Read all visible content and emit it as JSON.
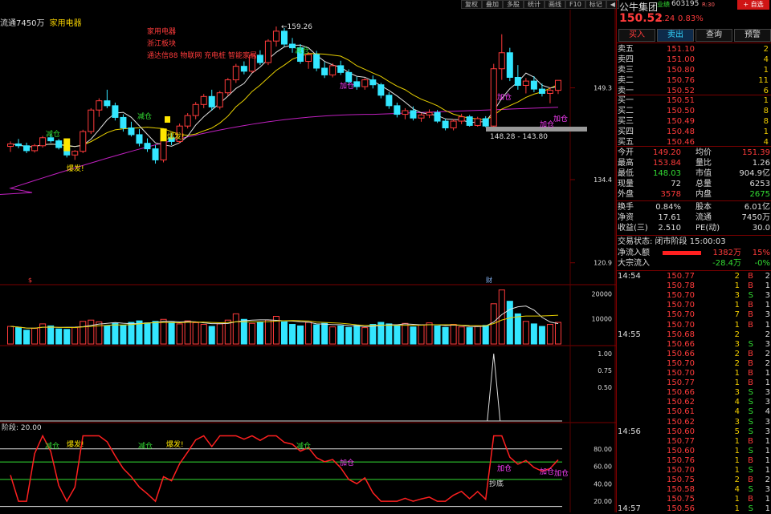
{
  "toolbar": {
    "buttons": [
      "复权",
      "叠加",
      "多股",
      "统计",
      "画线",
      "F10",
      "标记"
    ],
    "glyph": "◀"
  },
  "chart_header": {
    "left_text": "流通7450万",
    "sector": "家用电器"
  },
  "info_box": [
    "家用电器",
    "浙江板块",
    "通达信88 物联网 充电桩 智能家居"
  ],
  "price_axis": [
    "149.3",
    "134.4",
    "120.9"
  ],
  "price_annotations": {
    "high": "159.26",
    "range": "148.28 - 143.80"
  },
  "signals": {
    "jiancang": "减仓",
    "baofa": "爆发!",
    "jiacang": "加仓",
    "chaodi": "抄底"
  },
  "event_marks": [
    "$",
    "财"
  ],
  "volume_axis": [
    "20000",
    "10000"
  ],
  "osc_axis": [
    "1.00",
    "0.75",
    "0.50"
  ],
  "lower_title": "阶段: 20.00",
  "lower_axis": [
    "80.00",
    "60.00",
    "40.00",
    "20.00"
  ],
  "colors": {
    "up": "#ff3b3b",
    "down": "#33e6ff",
    "ma_yellow": "#e8d000",
    "ma_white": "#e0e0e0",
    "ma_purple": "#c020c0",
    "line_red": "#ff2020"
  },
  "stock": {
    "name": "公牛集团",
    "tag": "业绩",
    "code": "603195",
    "code_note": "R:30",
    "add_btn": "+ 自选",
    "price": "150.52",
    "change": "1.24",
    "pct": "0.83%"
  },
  "trade_buttons": [
    "买入",
    "卖出",
    "查询",
    "预警"
  ],
  "order_book": {
    "asks": [
      {
        "label": "卖五",
        "price": "151.10",
        "vol": "2"
      },
      {
        "label": "卖四",
        "price": "151.00",
        "vol": "4"
      },
      {
        "label": "卖三",
        "price": "150.80",
        "vol": "1"
      },
      {
        "label": "卖二",
        "price": "150.76",
        "vol": "11"
      },
      {
        "label": "卖一",
        "price": "150.52",
        "vol": "6"
      }
    ],
    "bids": [
      {
        "label": "买一",
        "price": "150.51",
        "vol": "1"
      },
      {
        "label": "买二",
        "price": "150.50",
        "vol": "8"
      },
      {
        "label": "买三",
        "price": "150.49",
        "vol": "8"
      },
      {
        "label": "买四",
        "price": "150.48",
        "vol": "1"
      },
      {
        "label": "买五",
        "price": "150.46",
        "vol": "4"
      }
    ]
  },
  "stats": [
    {
      "l1": "今开",
      "v1": "149.20",
      "l2": "均价",
      "v2": "151.39"
    },
    {
      "l1": "最高",
      "v1": "153.84",
      "l2": "量比",
      "v2": "1.26"
    },
    {
      "l1": "最低",
      "v1": "148.03",
      "l2": "市值",
      "v2": "904.9亿"
    },
    {
      "l1": "现量",
      "v1": "72",
      "l2": "总量",
      "v2": "6253"
    },
    {
      "l1": "外盘",
      "v1": "3578",
      "l2": "内盘",
      "v2": "2675"
    }
  ],
  "stats2": [
    {
      "l1": "换手",
      "v1": "0.84%",
      "l2": "股本",
      "v2": "6.01亿"
    },
    {
      "l1": "净资",
      "v1": "17.61",
      "l2": "流通",
      "v2": "7450万"
    },
    {
      "l1": "收益(三)",
      "v1": "2.510",
      "l2": "PE(动)",
      "v2": "30.0"
    }
  ],
  "status": "交易状态: 闭市阶段 15:00:03",
  "flow": [
    {
      "label": "净流入额",
      "value": "1382万",
      "pct": "15%"
    },
    {
      "label": "大宗流入",
      "value": "-28.4万",
      "pct": "-0%"
    }
  ],
  "ticks": [
    {
      "time": "14:54",
      "price": "150.77",
      "vol": "2",
      "side": "B",
      "n": "2"
    },
    {
      "time": "",
      "price": "150.78",
      "vol": "1",
      "side": "B",
      "n": "1"
    },
    {
      "time": "",
      "price": "150.70",
      "vol": "3",
      "side": "S",
      "n": "3"
    },
    {
      "time": "",
      "price": "150.70",
      "vol": "1",
      "side": "B",
      "n": "1"
    },
    {
      "time": "",
      "price": "150.70",
      "vol": "7",
      "side": "B",
      "n": "3"
    },
    {
      "time": "",
      "price": "150.70",
      "vol": "1",
      "side": "B",
      "n": "1"
    },
    {
      "time": "14:55",
      "price": "150.68",
      "vol": "2",
      "side": "",
      "n": "2"
    },
    {
      "time": "",
      "price": "150.66",
      "vol": "3",
      "side": "S",
      "n": "3"
    },
    {
      "time": "",
      "price": "150.66",
      "vol": "2",
      "side": "B",
      "n": "2"
    },
    {
      "time": "",
      "price": "150.70",
      "vol": "2",
      "side": "B",
      "n": "2"
    },
    {
      "time": "",
      "price": "150.70",
      "vol": "1",
      "side": "B",
      "n": "1"
    },
    {
      "time": "",
      "price": "150.77",
      "vol": "1",
      "side": "B",
      "n": "1"
    },
    {
      "time": "",
      "price": "150.66",
      "vol": "3",
      "side": "S",
      "n": "3"
    },
    {
      "time": "",
      "price": "150.62",
      "vol": "4",
      "side": "S",
      "n": "3"
    },
    {
      "time": "",
      "price": "150.61",
      "vol": "4",
      "side": "S",
      "n": "4"
    },
    {
      "time": "",
      "price": "150.62",
      "vol": "3",
      "side": "S",
      "n": "3"
    },
    {
      "time": "14:56",
      "price": "150.60",
      "vol": "5",
      "side": "S",
      "n": "3"
    },
    {
      "time": "",
      "price": "150.77",
      "vol": "1",
      "side": "B",
      "n": "1"
    },
    {
      "time": "",
      "price": "150.60",
      "vol": "1",
      "side": "S",
      "n": "1"
    },
    {
      "time": "",
      "price": "150.76",
      "vol": "1",
      "side": "B",
      "n": "1"
    },
    {
      "time": "",
      "price": "150.70",
      "vol": "1",
      "side": "S",
      "n": "1"
    },
    {
      "time": "",
      "price": "150.75",
      "vol": "2",
      "side": "B",
      "n": "2"
    },
    {
      "time": "",
      "price": "150.58",
      "vol": "4",
      "side": "S",
      "n": "3"
    },
    {
      "time": "",
      "price": "150.75",
      "vol": "1",
      "side": "B",
      "n": "1"
    },
    {
      "time": "14:57",
      "price": "150.56",
      "vol": "1",
      "side": "S",
      "n": "1"
    }
  ],
  "chart_data": {
    "type": "candlestick",
    "candles": [
      [
        139.8,
        140.6,
        138.9,
        140.2
      ],
      [
        140.2,
        141.0,
        139.5,
        139.9
      ],
      [
        139.9,
        140.4,
        138.7,
        139.1
      ],
      [
        139.1,
        140.2,
        138.8,
        139.9
      ],
      [
        139.9,
        141.5,
        139.6,
        141.2
      ],
      [
        141.2,
        141.8,
        140.4,
        140.7
      ],
      [
        140.7,
        141.0,
        139.3,
        139.6
      ],
      [
        139.6,
        139.9,
        138.0,
        138.4
      ],
      [
        138.4,
        139.2,
        137.6,
        139.0
      ],
      [
        139.0,
        142.5,
        138.7,
        142.2
      ],
      [
        142.2,
        146.0,
        141.8,
        145.7
      ],
      [
        145.7,
        147.6,
        144.6,
        147.2
      ],
      [
        147.2,
        149.0,
        146.0,
        146.4
      ],
      [
        146.4,
        146.9,
        144.0,
        144.5
      ],
      [
        144.5,
        145.0,
        142.2,
        142.8
      ],
      [
        142.8,
        143.8,
        141.4,
        141.7
      ],
      [
        141.7,
        142.6,
        139.8,
        140.3
      ],
      [
        140.3,
        141.1,
        138.9,
        139.4
      ],
      [
        139.4,
        140.0,
        137.0,
        137.6
      ],
      [
        137.6,
        141.6,
        137.2,
        141.2
      ],
      [
        141.2,
        142.0,
        140.0,
        140.6
      ],
      [
        140.6,
        143.5,
        140.3,
        143.1
      ],
      [
        143.1,
        145.2,
        142.7,
        144.8
      ],
      [
        144.8,
        147.0,
        144.2,
        146.6
      ],
      [
        146.6,
        148.3,
        146.0,
        147.9
      ],
      [
        147.9,
        149.0,
        145.6,
        146.2
      ],
      [
        146.2,
        148.8,
        145.8,
        148.5
      ],
      [
        148.5,
        150.9,
        148.0,
        150.6
      ],
      [
        150.6,
        153.2,
        150.1,
        152.8
      ],
      [
        152.8,
        153.6,
        151.5,
        152.0
      ],
      [
        152.0,
        154.9,
        151.7,
        154.6
      ],
      [
        154.6,
        155.4,
        153.0,
        153.4
      ],
      [
        153.4,
        157.2,
        153.0,
        156.9
      ],
      [
        156.9,
        159.26,
        156.0,
        158.5
      ],
      [
        158.5,
        159.0,
        156.0,
        156.4
      ],
      [
        156.4,
        157.4,
        155.0,
        155.8
      ],
      [
        155.8,
        156.4,
        153.2,
        153.6
      ],
      [
        153.6,
        155.1,
        152.4,
        154.7
      ],
      [
        154.7,
        155.3,
        152.0,
        152.5
      ],
      [
        152.5,
        153.5,
        150.9,
        151.4
      ],
      [
        151.4,
        153.3,
        151.0,
        152.9
      ],
      [
        152.9,
        153.7,
        151.4,
        151.8
      ],
      [
        151.8,
        152.3,
        150.0,
        150.3
      ],
      [
        150.3,
        151.1,
        149.0,
        149.5
      ],
      [
        149.5,
        150.9,
        149.0,
        150.6
      ],
      [
        150.6,
        151.3,
        149.2,
        149.8
      ],
      [
        149.8,
        150.1,
        147.6,
        148.1
      ],
      [
        148.1,
        148.6,
        145.9,
        146.4
      ],
      [
        146.4,
        146.9,
        144.5,
        145.0
      ],
      [
        145.0,
        146.0,
        144.2,
        145.6
      ],
      [
        145.6,
        146.3,
        144.0,
        144.4
      ],
      [
        144.4,
        145.2,
        143.8,
        144.9
      ],
      [
        144.9,
        145.8,
        144.4,
        145.3
      ],
      [
        145.3,
        145.7,
        143.6,
        143.9
      ],
      [
        143.9,
        144.3,
        142.4,
        142.8
      ],
      [
        142.8,
        144.2,
        142.4,
        143.9
      ],
      [
        143.9,
        145.1,
        143.4,
        144.6
      ],
      [
        144.6,
        144.9,
        143.0,
        143.2
      ],
      [
        143.2,
        144.6,
        143.0,
        144.3
      ],
      [
        144.3,
        144.7,
        142.9,
        143.1
      ],
      [
        143.1,
        153.2,
        142.8,
        152.4
      ],
      [
        152.4,
        158.0,
        150.6,
        155.0
      ],
      [
        155.0,
        155.8,
        150.4,
        151.0
      ],
      [
        151.0,
        153.0,
        149.0,
        149.7
      ],
      [
        149.7,
        150.9,
        148.4,
        150.4
      ],
      [
        150.4,
        151.2,
        148.6,
        149.1
      ],
      [
        149.1,
        150.0,
        147.9,
        148.4
      ],
      [
        148.4,
        149.4,
        146.8,
        148.9
      ],
      [
        148.9,
        150.5,
        148.3,
        150.52
      ]
    ],
    "volume": [
      7000,
      6500,
      5500,
      6200,
      8000,
      7200,
      6000,
      5800,
      6500,
      9000,
      9500,
      8800,
      7200,
      8200,
      7500,
      8600,
      9200,
      8400,
      9000,
      9800,
      8600,
      8000,
      9200,
      8500,
      7800,
      7000,
      8000,
      9500,
      12000,
      9800,
      8200,
      8600,
      9500,
      11000,
      8800,
      7800,
      7200,
      8600,
      7600,
      8200,
      6800,
      7200,
      6600,
      7400,
      6500,
      7800,
      8600,
      8000,
      7400,
      8200,
      6800,
      7600,
      8400,
      7200,
      6600,
      7800,
      6800,
      6500,
      7000,
      7400,
      16000,
      21500,
      17000,
      12000,
      9000,
      8000,
      7000,
      7800,
      8600
    ],
    "volume_axis_range": [
      0,
      22000
    ],
    "oscillator_spike": 1.0,
    "lower_line_range": [
      10,
      100
    ],
    "xlabel": "",
    "ylabel": ""
  }
}
